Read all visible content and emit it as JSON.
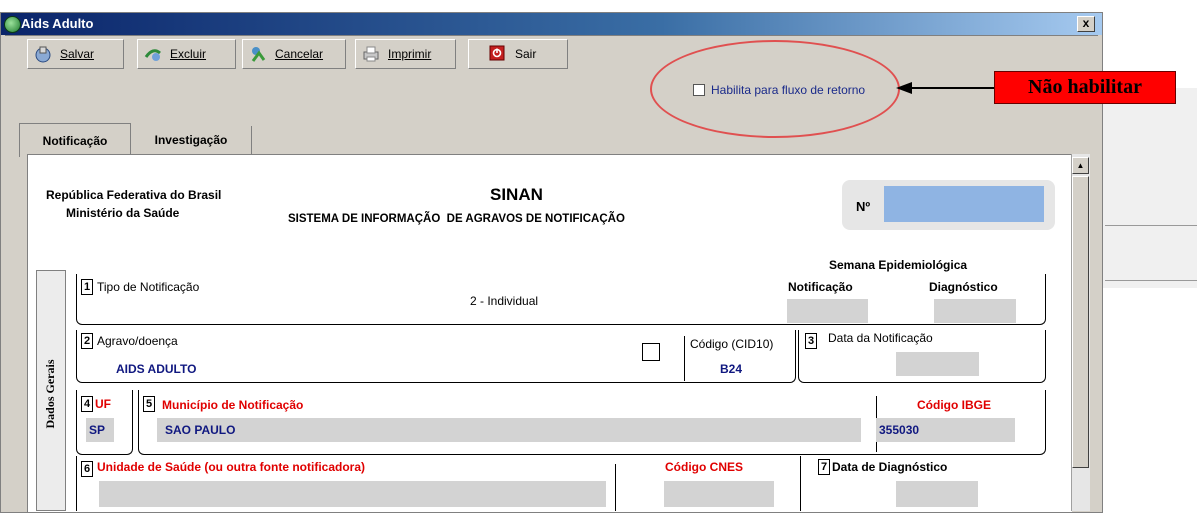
{
  "window": {
    "title": "Aids Adulto",
    "close_label": "x"
  },
  "toolbar": {
    "buttons": [
      {
        "label": "Salvar",
        "icon": "save-icon"
      },
      {
        "label": "Excluir",
        "icon": "delete-icon"
      },
      {
        "label": "Cancelar",
        "icon": "cancel-icon"
      },
      {
        "label": "Imprimir",
        "icon": "print-icon"
      },
      {
        "label": "Sair",
        "icon": "exit-icon"
      }
    ]
  },
  "return_flow": {
    "label": "Habilita para fluxo de retorno",
    "checked": false
  },
  "annotation": {
    "text": "Não habilitar",
    "color": "#ff0000"
  },
  "tabs": [
    {
      "label": "Notificação"
    },
    {
      "label": "Investigação"
    }
  ],
  "header": {
    "republic": "República Federativa do Brasil",
    "ministry": "Ministério da Saúde",
    "system_title": "SINAN",
    "system_subtitle": "SISTEMA DE INFORMAÇÃO  DE AGRAVOS DE NOTIFICAÇÃO",
    "number_label": "Nº",
    "number_value": ""
  },
  "side_tab": {
    "label": "Dados Gerais"
  },
  "form": {
    "epi_week": {
      "title": "Semana Epidemiológica",
      "notification": "Notificação",
      "diagnosis": "Diagnóstico"
    },
    "f1": {
      "num": "1",
      "label": "Tipo de Notificação",
      "value": "2 - Individual"
    },
    "f2": {
      "num": "2",
      "label": "Agravo/doença",
      "value": "AIDS ADULTO"
    },
    "cid": {
      "label": "Código (CID10)",
      "value": "B24"
    },
    "f3": {
      "num": "3",
      "label": "Data da Notificação",
      "value": ""
    },
    "f4": {
      "num": "4",
      "label": "UF",
      "value": "SP"
    },
    "f5": {
      "num": "5",
      "label": "Município de Notificação",
      "value": "SAO PAULO"
    },
    "ibge": {
      "label": "Código IBGE",
      "value": "355030"
    },
    "f6": {
      "num": "6",
      "label": "Unidade de Saúde (ou outra fonte notificadora)",
      "value": ""
    },
    "cnes": {
      "label": "Código CNES",
      "value": ""
    },
    "f7": {
      "num": "7",
      "label": "Data de Diagnóstico",
      "value": ""
    }
  }
}
